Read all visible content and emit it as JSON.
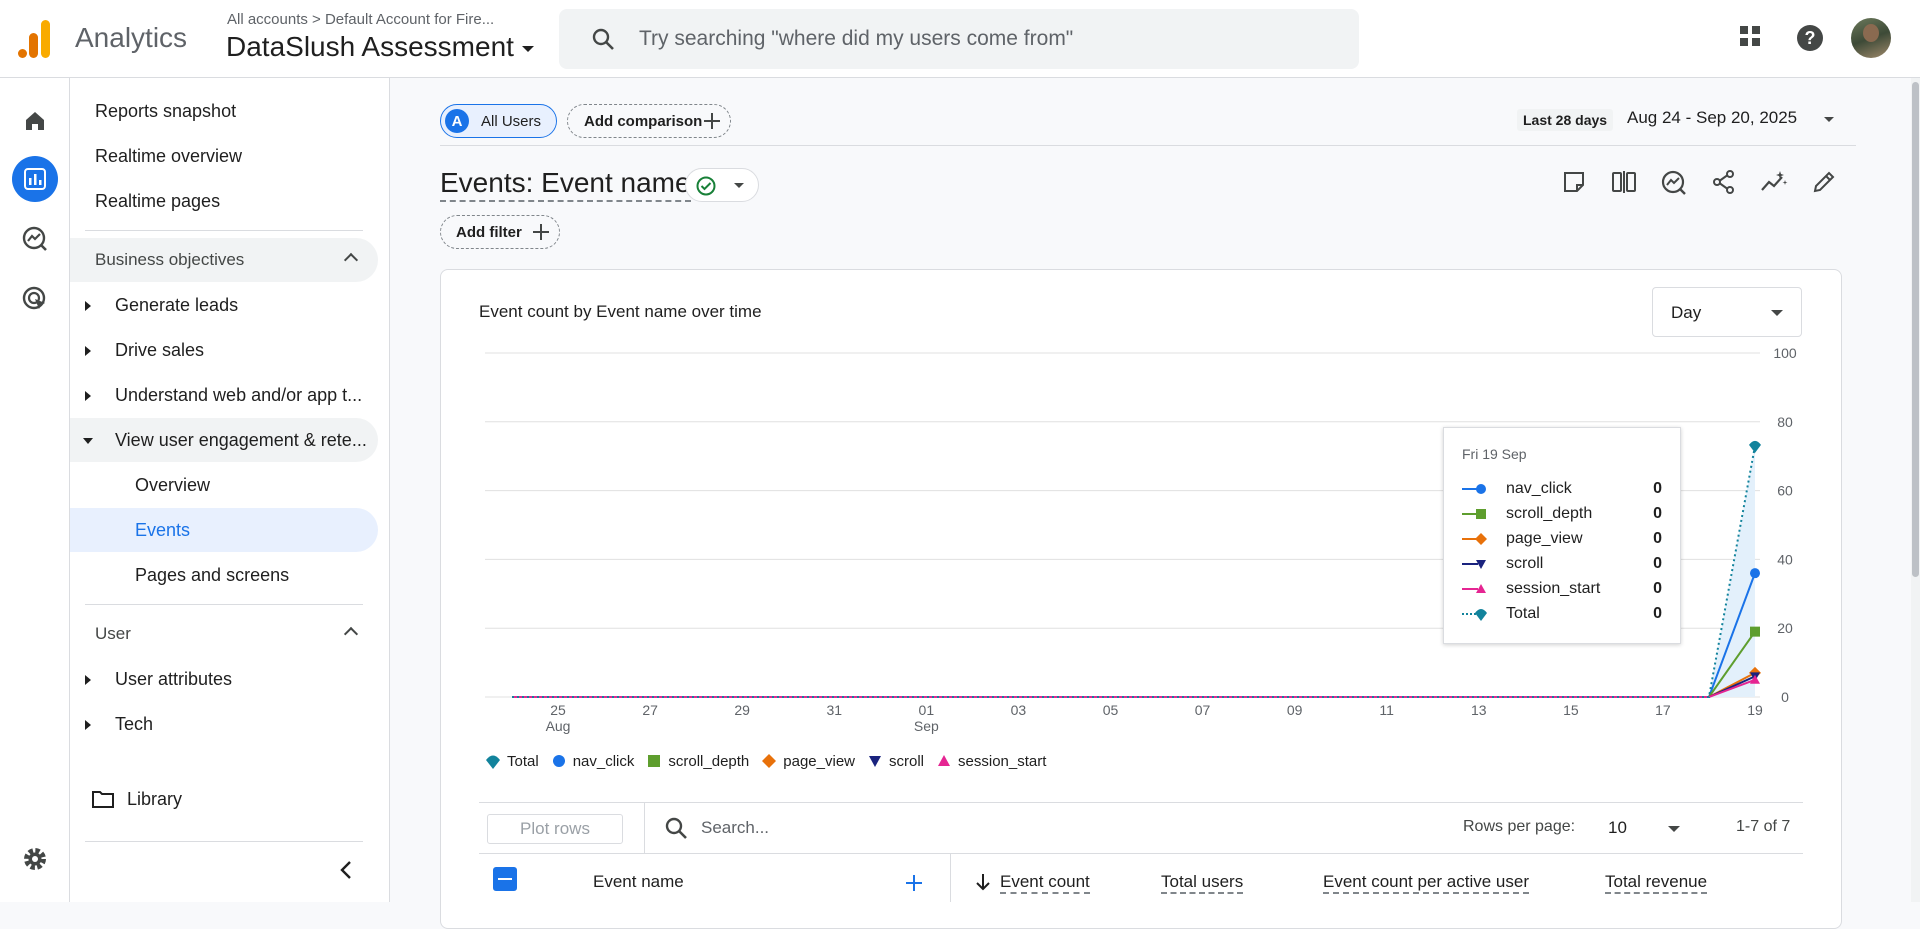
{
  "app": {
    "name": "Analytics",
    "breadcrumb": "All accounts > Default Account for Fire...",
    "property": "DataSlush Assessment",
    "search_placeholder": "Try searching \"where did my users come from\""
  },
  "sidebar": {
    "items": [
      {
        "label": "Reports snapshot"
      },
      {
        "label": "Realtime overview"
      },
      {
        "label": "Realtime pages"
      },
      {
        "label": "Business objectives"
      },
      {
        "label": "Generate leads"
      },
      {
        "label": "Drive sales"
      },
      {
        "label": "Understand web and/or app t..."
      },
      {
        "label": "View user engagement & rete..."
      },
      {
        "label": "Overview"
      },
      {
        "label": "Events"
      },
      {
        "label": "Pages and screens"
      },
      {
        "label": "User"
      },
      {
        "label": "User attributes"
      },
      {
        "label": "Tech"
      },
      {
        "label": "Library"
      }
    ]
  },
  "toolbar": {
    "segment_badge": "A",
    "segment_label": "All Users",
    "add_comparison": "Add comparison",
    "date_label": "Last 28 days",
    "date_range": "Aug 24 - Sep 20, 2025",
    "add_filter": "Add filter"
  },
  "page": {
    "title": "Events: Event name"
  },
  "card": {
    "title": "Event count by Event name over time",
    "granularity": "Day"
  },
  "colors": {
    "nav_click": "#1a73e8",
    "scroll_depth": "#5e9e2e",
    "page_view": "#e8710a",
    "scroll": "#1a237e",
    "session_start": "#e52592",
    "total": "#12839c",
    "accent": "#1a73e8"
  },
  "chart_data": {
    "type": "line",
    "x": [
      "24 Aug",
      "25 Aug",
      "26 Aug",
      "27 Aug",
      "28 Aug",
      "29 Aug",
      "30 Aug",
      "31 Aug",
      "01 Sep",
      "02 Sep",
      "03 Sep",
      "04 Sep",
      "05 Sep",
      "06 Sep",
      "07 Sep",
      "08 Sep",
      "09 Sep",
      "10 Sep",
      "11 Sep",
      "12 Sep",
      "13 Sep",
      "14 Sep",
      "15 Sep",
      "16 Sep",
      "17 Sep",
      "18 Sep",
      "19 Sep",
      "20 Sep"
    ],
    "x_tick_labels": [
      {
        "day": "25",
        "month": "Aug"
      },
      {
        "day": "27",
        "month": ""
      },
      {
        "day": "29",
        "month": ""
      },
      {
        "day": "31",
        "month": ""
      },
      {
        "day": "01",
        "month": "Sep"
      },
      {
        "day": "03",
        "month": ""
      },
      {
        "day": "05",
        "month": ""
      },
      {
        "day": "07",
        "month": ""
      },
      {
        "day": "09",
        "month": ""
      },
      {
        "day": "11",
        "month": ""
      },
      {
        "day": "13",
        "month": ""
      },
      {
        "day": "15",
        "month": ""
      },
      {
        "day": "17",
        "month": ""
      },
      {
        "day": "19",
        "month": ""
      }
    ],
    "y_ticks": [
      0,
      20,
      40,
      60,
      80,
      100
    ],
    "ylim": [
      0,
      100
    ],
    "grid": true,
    "series": [
      {
        "name": "nav_click",
        "color": "#1a73e8",
        "marker": "circle",
        "values": [
          0,
          0,
          0,
          0,
          0,
          0,
          0,
          0,
          0,
          0,
          0,
          0,
          0,
          0,
          0,
          0,
          0,
          0,
          0,
          0,
          0,
          0,
          0,
          0,
          0,
          0,
          0,
          36
        ]
      },
      {
        "name": "scroll_depth",
        "color": "#5e9e2e",
        "marker": "square",
        "values": [
          0,
          0,
          0,
          0,
          0,
          0,
          0,
          0,
          0,
          0,
          0,
          0,
          0,
          0,
          0,
          0,
          0,
          0,
          0,
          0,
          0,
          0,
          0,
          0,
          0,
          0,
          0,
          19
        ]
      },
      {
        "name": "page_view",
        "color": "#e8710a",
        "marker": "diamond",
        "values": [
          0,
          0,
          0,
          0,
          0,
          0,
          0,
          0,
          0,
          0,
          0,
          0,
          0,
          0,
          0,
          0,
          0,
          0,
          0,
          0,
          0,
          0,
          0,
          0,
          0,
          0,
          0,
          7
        ]
      },
      {
        "name": "scroll",
        "color": "#1a237e",
        "marker": "triangle-down",
        "values": [
          0,
          0,
          0,
          0,
          0,
          0,
          0,
          0,
          0,
          0,
          0,
          0,
          0,
          0,
          0,
          0,
          0,
          0,
          0,
          0,
          0,
          0,
          0,
          0,
          0,
          0,
          0,
          6
        ]
      },
      {
        "name": "session_start",
        "color": "#e52592",
        "marker": "triangle-up",
        "values": [
          0,
          0,
          0,
          0,
          0,
          0,
          0,
          0,
          0,
          0,
          0,
          0,
          0,
          0,
          0,
          0,
          0,
          0,
          0,
          0,
          0,
          0,
          0,
          0,
          0,
          0,
          0,
          5
        ]
      },
      {
        "name": "Total",
        "color": "#12839c",
        "marker": "pin",
        "dashed": true,
        "values": [
          0,
          0,
          0,
          0,
          0,
          0,
          0,
          0,
          0,
          0,
          0,
          0,
          0,
          0,
          0,
          0,
          0,
          0,
          0,
          0,
          0,
          0,
          0,
          0,
          0,
          0,
          0,
          73
        ]
      }
    ],
    "tooltip": {
      "date": "Fri 19 Sep",
      "rows": [
        {
          "name": "nav_click",
          "value": "0"
        },
        {
          "name": "scroll_depth",
          "value": "0"
        },
        {
          "name": "page_view",
          "value": "0"
        },
        {
          "name": "scroll",
          "value": "0"
        },
        {
          "name": "session_start",
          "value": "0"
        },
        {
          "name": "Total",
          "value": "0"
        }
      ]
    },
    "legend": [
      "Total",
      "nav_click",
      "scroll_depth",
      "page_view",
      "scroll",
      "session_start"
    ]
  },
  "table": {
    "plot_rows": "Plot rows",
    "search_placeholder": "Search...",
    "rows_per_page_label": "Rows per page:",
    "rows_per_page": "10",
    "pagination": "1-7 of 7",
    "columns": [
      "Event name",
      "Event count",
      "Total users",
      "Event count per active user",
      "Total revenue"
    ]
  }
}
